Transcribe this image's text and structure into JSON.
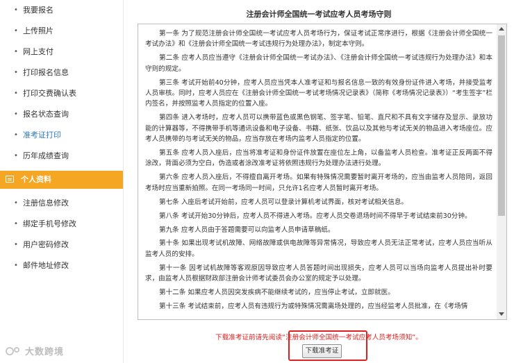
{
  "sidebar": {
    "items": [
      {
        "label": "我要报名"
      },
      {
        "label": "上传照片"
      },
      {
        "label": "网上支付"
      },
      {
        "label": "打印报名信息"
      },
      {
        "label": "打印交费确认表"
      },
      {
        "label": "报名状态查询"
      },
      {
        "label": "准考证打印",
        "active": true
      },
      {
        "label": "历年成绩查询"
      }
    ],
    "section": {
      "title": "个人资料",
      "icon": "id-card-icon"
    },
    "section_items": [
      {
        "label": "注册信息修改"
      },
      {
        "label": "绑定手机号修改"
      },
      {
        "label": "用户密码修改"
      },
      {
        "label": "邮件地址修改"
      }
    ],
    "logo_text": "大数跨境"
  },
  "colors": {
    "accent": "#f5a623",
    "active_link": "#2e78c8",
    "notice": "#e02020"
  },
  "main": {
    "title": "注册会计师全国统一考试应考人员考场守则",
    "rules": [
      "第一条 为了规范注册会计师全国统一考试应考人员考场行为，保证考试正常序进行，根据《注册会计师全国统一考试办法》和《注册会计师全国统一考试违规行为处理办法》，制定本守则。",
      "第二条 应考人员应当遵守《注册会计师全国统一考试办法》、《注册会计师全国统一考试违规行为处理办法》和本守则的规定。",
      "第三条 考试开始前40分钟，应考人员应当凭本人准考证和与报名信息一致的有效身份证件进入考场，并接受监考人员审核。同时，应考人员应在《注册会计师全国统一考试考场情况记录表》（简称《考场情况记录表》）“考生签字”栏内签名，并按照监考人员指定的位置入座。",
      "第四条 进入考场时，应考人员可以携带蓝色或黑色钢笔、签字笔、铅笔、直尺和不具有文字储存及显示、录放功能的计算器等，不得携带手机等通讯设备和电子设备、书籍、纸张、饮品以及其他与考试无关的物品进入考场座位。应考人员携带的与考试无关的物品，应当存放在考场内监考人员指定的位置。",
      "第五条 应考人员入座后，应当将准考证和身份证件放置在座位左上角，以备监考人员检查。准考证正反两面不得涂改，背面必须为空白，伪造或者涂改准考证将依照违规行为处理办法进行处理。",
      "第六条 应考人员入座后，不得擅自离开考场。如果有特殊情况需要暂时离开考场的，应当由监考人员陪同，返回考场时应当重新拍照。在同一考场同一时间，只允许1名应考人员暂时离开考场。",
      "第七条 入座后考试开始前，应考人员可以登录计算机考试界面，核对考试相关信息。",
      "第八条 考试开始30分钟后，应考人员不得进入考场。应考人员交卷退场时间不得早于考试结束前30分钟。",
      "第九条 应考人员由于答题需要可以向监考人员申请草稿纸。",
      "第十条 如果出现考试机故障、网络故障或供电故障等异常情况，导致应考人员无法正常考试，应考人员应当听从监考人员的安排。",
      "第十一条 因考试机故障等客观原因导致应考人员答题时间出现损失，应考人员可以当场向监考人员提出补时要求，由监考人员根据财政部注册会计师考试委员会办公室的规定予以处理。",
      "第十二条 如果应考人员因突发疾病不能继续考试的，应当停止考试，立即就医。",
      "第十三条 考试结束前，应考人员有违规行为或特殊情况需离场处理的，应当经监考人员批准，在《考场情"
    ],
    "download_notice": "下载准考证前请先阅读“注册会计师全国统一考试应考人员考场须知”。",
    "download_button": "下载准考证"
  }
}
